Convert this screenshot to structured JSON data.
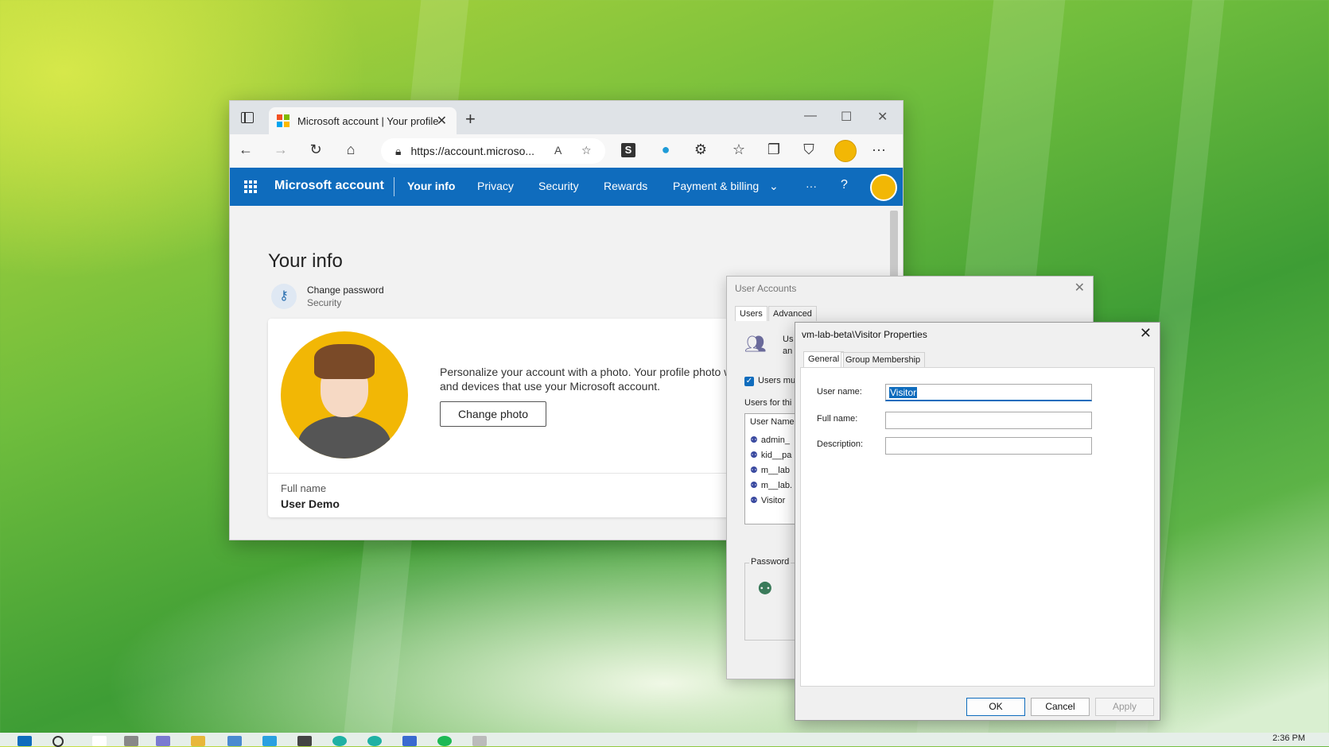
{
  "browser": {
    "tab_title": "Microsoft account | Your profile",
    "address": "https://account.microso...",
    "ext_s": "S"
  },
  "ms_nav": {
    "brand": "Microsoft account",
    "items": [
      "Your info",
      "Privacy",
      "Security",
      "Rewards",
      "Payment & billing"
    ],
    "more": "···",
    "help": "?"
  },
  "profile": {
    "page_title": "Your info",
    "change_password": "Change password",
    "security": "Security",
    "photo_text_1": "Personalize your account with a photo. Your profile photo w",
    "photo_text_2": "and devices that use your Microsoft account.",
    "change_photo": "Change photo",
    "full_name_label": "Full name",
    "full_name_value": "User Demo"
  },
  "user_accounts": {
    "title": "User Accounts",
    "tabs": [
      "Users",
      "Advanced"
    ],
    "cut_text_1": "Us",
    "cut_text_2": "an",
    "users_must": "Users mu",
    "users_for": "Users for thi",
    "list_header": "User Name",
    "users": [
      "admin_",
      "kid__pa",
      "m__lab",
      "m__lab.",
      "Visitor"
    ],
    "password_label": "Password"
  },
  "visitor_props": {
    "title": "vm-lab-beta\\Visitor Properties",
    "tabs": [
      "General",
      "Group Membership"
    ],
    "user_name_label": "User name:",
    "user_name_value": "Visitor",
    "full_name_label": "Full name:",
    "full_name_value": "",
    "description_label": "Description:",
    "description_value": "",
    "ok": "OK",
    "cancel": "Cancel",
    "apply": "Apply"
  },
  "taskbar": {
    "time": "2:36 PM"
  },
  "colors": {
    "accent": "#0f6cbd",
    "avatar": "#f2b705"
  }
}
